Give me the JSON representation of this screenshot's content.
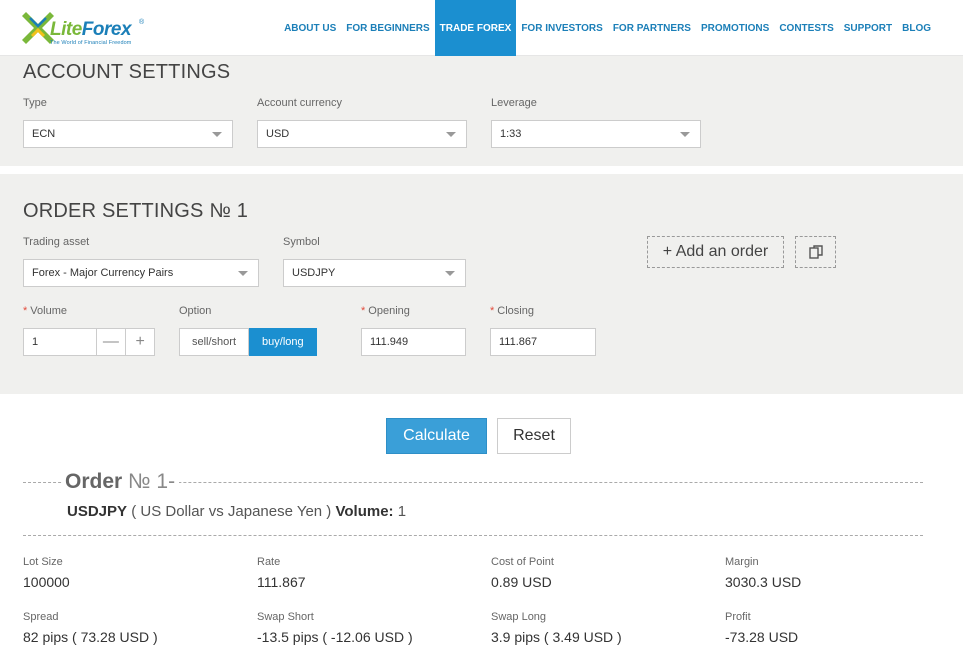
{
  "header": {
    "logo_lite": "Lite",
    "logo_forex": "Forex",
    "logo_tagline": "The World of Financial Freedom",
    "nav": [
      {
        "label": "ABOUT US",
        "active": false
      },
      {
        "label": "FOR BEGINNERS",
        "active": false
      },
      {
        "label": "TRADE FOREX",
        "active": true
      },
      {
        "label": "FOR INVESTORS",
        "active": false
      },
      {
        "label": "FOR PARTNERS",
        "active": false
      },
      {
        "label": "PROMOTIONS",
        "active": false
      },
      {
        "label": "CONTESTS",
        "active": false
      },
      {
        "label": "SUPPORT",
        "active": false
      },
      {
        "label": "BLOG",
        "active": false
      }
    ]
  },
  "account": {
    "title": "ACCOUNT SETTINGS",
    "type_label": "Type",
    "type_value": "ECN",
    "currency_label": "Account currency",
    "currency_value": "USD",
    "leverage_label": "Leverage",
    "leverage_value": "1:33"
  },
  "order": {
    "title": "ORDER SETTINGS № 1",
    "asset_label": "Trading asset",
    "asset_value": "Forex - Major Currency Pairs",
    "symbol_label": "Symbol",
    "symbol_value": "USDJPY",
    "add_order_label": "+ Add an order",
    "volume_label": "Volume",
    "volume_value": "1",
    "minus": "—",
    "plus": "+",
    "option_label": "Option",
    "option_sell": "sell/short",
    "option_buy": "buy/long",
    "opening_label": "Opening",
    "opening_value": "111.949",
    "closing_label": "Closing",
    "closing_value": "111.867"
  },
  "actions": {
    "calculate": "Calculate",
    "reset": "Reset"
  },
  "result": {
    "order_word": "Order",
    "order_num": "№ 1-",
    "symbol": "USDJPY",
    "symbol_desc": " ( US Dollar vs Japanese Yen ) ",
    "volume_word": "Volume:",
    "volume_value": " 1",
    "lot_size_label": "Lot Size",
    "lot_size_value": "100000",
    "rate_label": "Rate",
    "rate_value": "111.867",
    "cost_label": "Cost of Point",
    "cost_value": "0.89 USD",
    "margin_label": "Margin",
    "margin_value": "3030.3 USD",
    "spread_label": "Spread",
    "spread_value": "82 pips ( 73.28 USD )",
    "swap_short_label": "Swap Short",
    "swap_short_value": "-13.5 pips ( -12.06 USD )",
    "swap_long_label": "Swap Long",
    "swap_long_value": "3.9 pips ( 3.49 USD )",
    "profit_label": "Profit",
    "profit_value": "-73.28 USD"
  },
  "colors": {
    "brand_blue": "#1b8fd0",
    "brand_green": "#7ab83a",
    "section_bg": "#f0f0ee",
    "required": "#e24b3b"
  }
}
